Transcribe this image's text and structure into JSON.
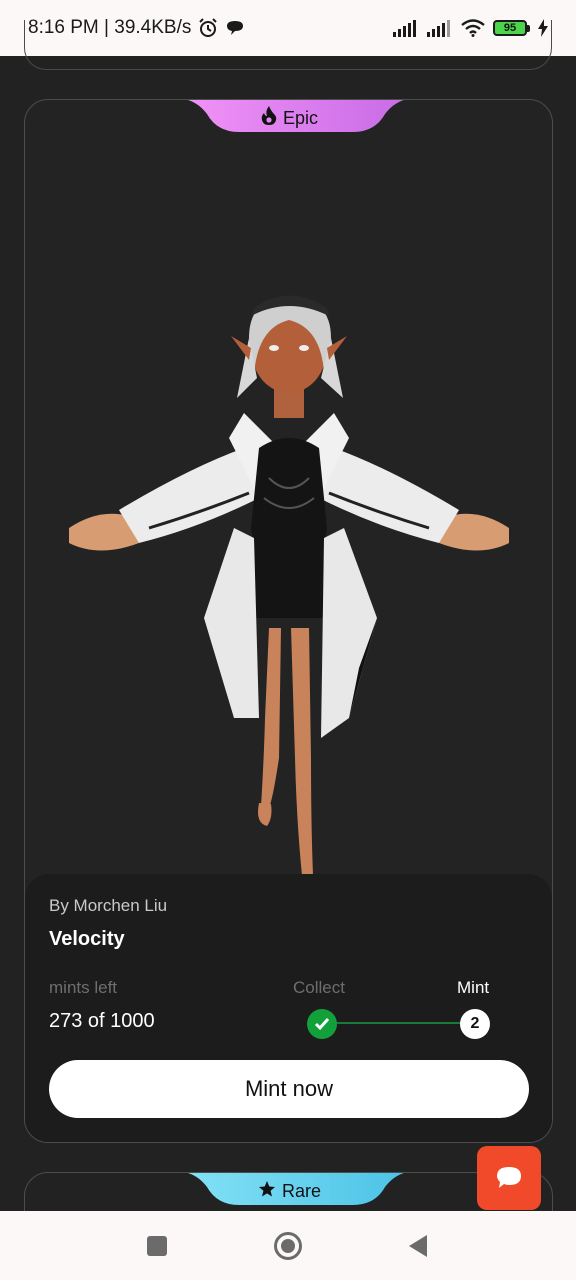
{
  "status_bar": {
    "time_speed": "8:16 PM | 39.4KB/s",
    "battery_level": "95",
    "icons": [
      "alarm-icon",
      "chat-bubble-icon",
      "signal-icon",
      "signal-icon",
      "wifi-icon",
      "battery-icon",
      "charging-icon"
    ]
  },
  "card": {
    "rarity": "Epic",
    "rarity_icon": "flame-icon",
    "rarity_gradient": [
      "#f08cf5",
      "#c86de8"
    ],
    "creator": "By Morchen Liu",
    "title": "Velocity",
    "mints_label": "mints left",
    "mints_value": "273 of 1000",
    "steps": {
      "collect_label": "Collect",
      "mint_label": "Mint",
      "mint_number": "2"
    },
    "mint_button": "Mint now"
  },
  "next_card": {
    "rarity": "Rare",
    "rarity_icon": "star-icon",
    "rarity_gradient": [
      "#7fe0f5",
      "#4cc4e8"
    ]
  },
  "chat_fab": {
    "icon": "chat-icon",
    "color": "#f04a2a"
  },
  "nav_bar": {
    "icons": [
      "square-icon",
      "home-circle-icon",
      "back-triangle-icon"
    ]
  }
}
